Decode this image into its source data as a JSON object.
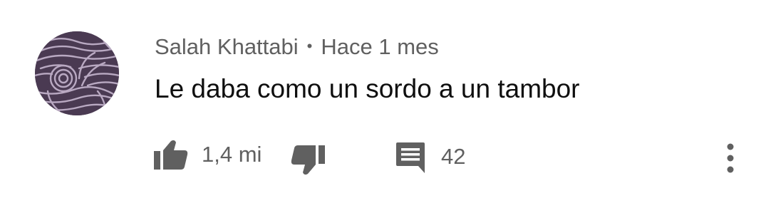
{
  "comment": {
    "author": "Salah Khattabi",
    "separator": "•",
    "time": "Hace 1 mes",
    "text": "Le daba como un sordo a un tambor"
  },
  "actions": {
    "like_icon": "thumbs-up-icon",
    "like_count": "1,4 mi",
    "dislike_icon": "thumbs-down-icon",
    "reply_icon": "comment-icon",
    "reply_count": "42",
    "more_icon": "more-vertical-icon"
  },
  "colors": {
    "secondary_text": "#606060",
    "primary_text": "#0f0f0f",
    "avatar_bg": "#4a3a52",
    "avatar_pattern": "#b9a9c2"
  }
}
